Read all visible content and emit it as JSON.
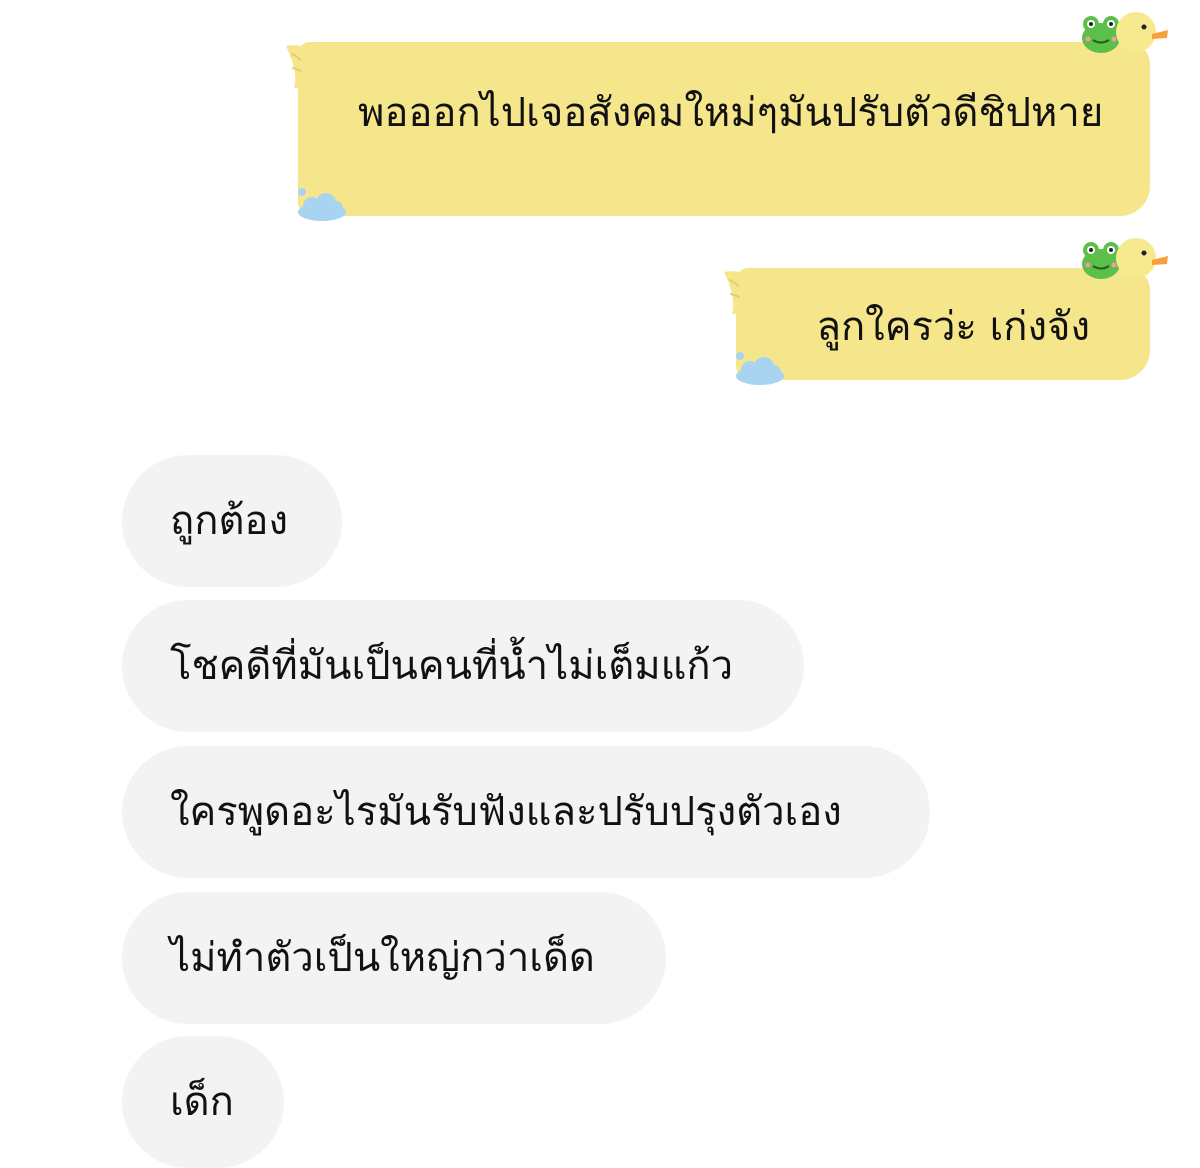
{
  "sent_messages": [
    {
      "text": "พอออกไปเจอสังคมใหม่ๆมันปรับตัวดีชิปหาย"
    },
    {
      "text": "ลูกใครว่ะ เก่งจัง"
    }
  ],
  "received_messages": [
    {
      "text": "ถูกต้อง"
    },
    {
      "text": "โชคดีที่มันเป็นคนที่น้ำไม่เต็มแก้ว"
    },
    {
      "text": "ใครพูดอะไรมันรับฟังและปรับปรุงตัวเอง"
    },
    {
      "text": "ไม่ทำตัวเป็นใหญ่กว่าเด็ด"
    },
    {
      "text": "เด็ก"
    }
  ],
  "theme": {
    "sent_bubble_color": "#f5e68c",
    "received_bubble_color": "#f3f3f3",
    "duck_color": "#f7e98e",
    "duck_beak_color": "#f5a03a",
    "frog_color": "#5cbf4a",
    "cloud_color": "#a8d4f2"
  },
  "icons": {
    "duck": "duck-icon",
    "frog": "frog-icon",
    "cloud": "cloud-icon"
  }
}
